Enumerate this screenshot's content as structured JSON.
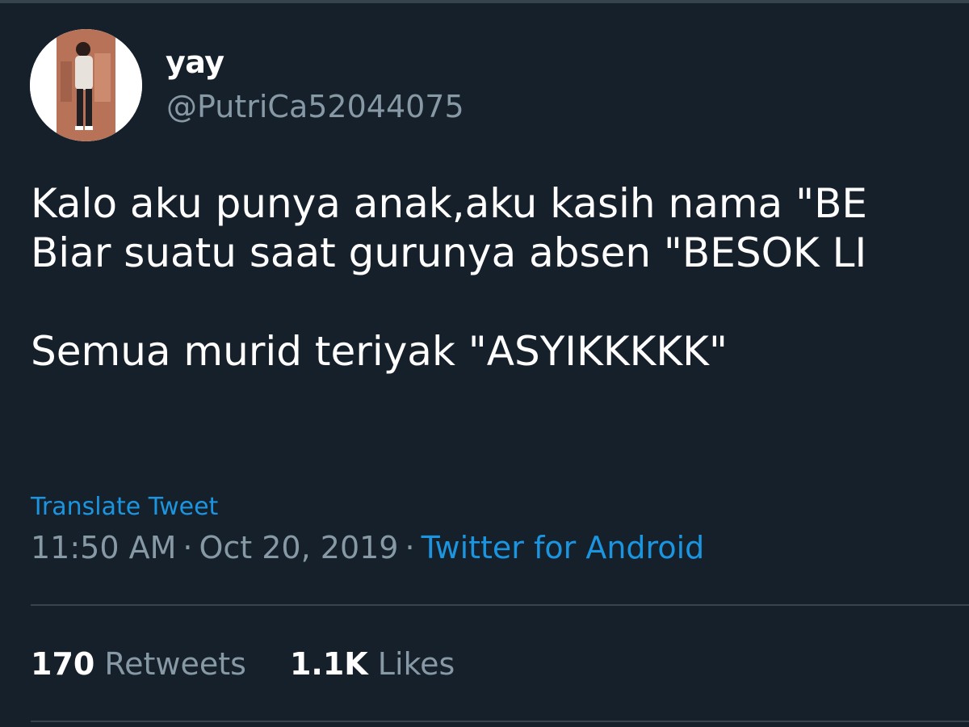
{
  "user": {
    "display_name": "yay",
    "handle": "@PutriCa52044075"
  },
  "tweet": {
    "lines": [
      "Kalo aku punya anak,aku kasih nama \"BE",
      "Biar suatu saat gurunya absen \"BESOK LI",
      "",
      "Semua murid teriyak \"ASYIKKKKK\""
    ]
  },
  "translate_label": "Translate Tweet",
  "meta": {
    "time": "11:50 AM",
    "separator": "·",
    "date": "Oct 20, 2019",
    "source": "Twitter for Android"
  },
  "stats": {
    "retweets_count": "170",
    "retweets_label": "Retweets",
    "likes_count": "1.1K",
    "likes_label": "Likes"
  },
  "colors": {
    "background": "#15202b",
    "primary_text": "#ffffff",
    "secondary_text": "#8899a6",
    "link": "#1b95e0",
    "divider": "#38444d"
  },
  "icons": {
    "avatar": "profile-photo"
  }
}
